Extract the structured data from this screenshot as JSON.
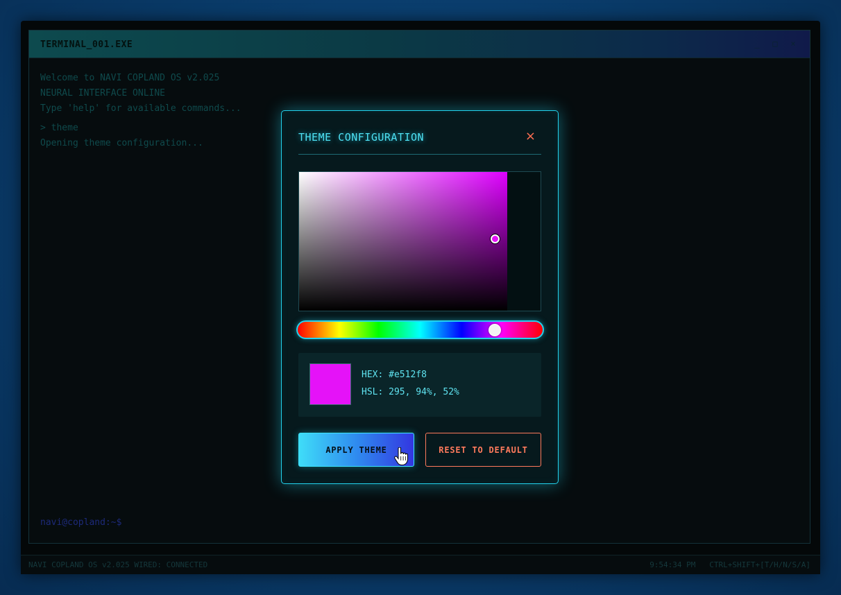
{
  "terminal": {
    "title": "TERMINAL_001.EXE",
    "controls": {
      "minimize": "_",
      "maximize": "□",
      "close": "×"
    },
    "lines": [
      "Welcome to NAVI COPLAND OS v2.025",
      "NEURAL INTERFACE ONLINE",
      "Type 'help' for available commands..."
    ],
    "command": "> theme",
    "response": "Opening theme configuration...",
    "prompt": "navi@copland:~$"
  },
  "statusbar": {
    "left": "NAVI COPLAND OS v2.025  WIRED: CONNECTED",
    "time": "9:54:34 PM",
    "shortcut": "CTRL+SHIFT+[T/H/N/S/A]"
  },
  "modal": {
    "title": "THEME CONFIGURATION",
    "close_label": "×",
    "color": {
      "hex_label": "HEX: #e512f8",
      "hsl_label": "HSL: 295, 94%, 52%",
      "swatch_color": "#e512f8"
    },
    "apply_label": "APPLY THEME",
    "reset_label": "RESET TO DEFAULT"
  },
  "colors": {
    "accent": "#22d3ee",
    "danger": "#ff7a5c",
    "selected": "#e512f8"
  }
}
